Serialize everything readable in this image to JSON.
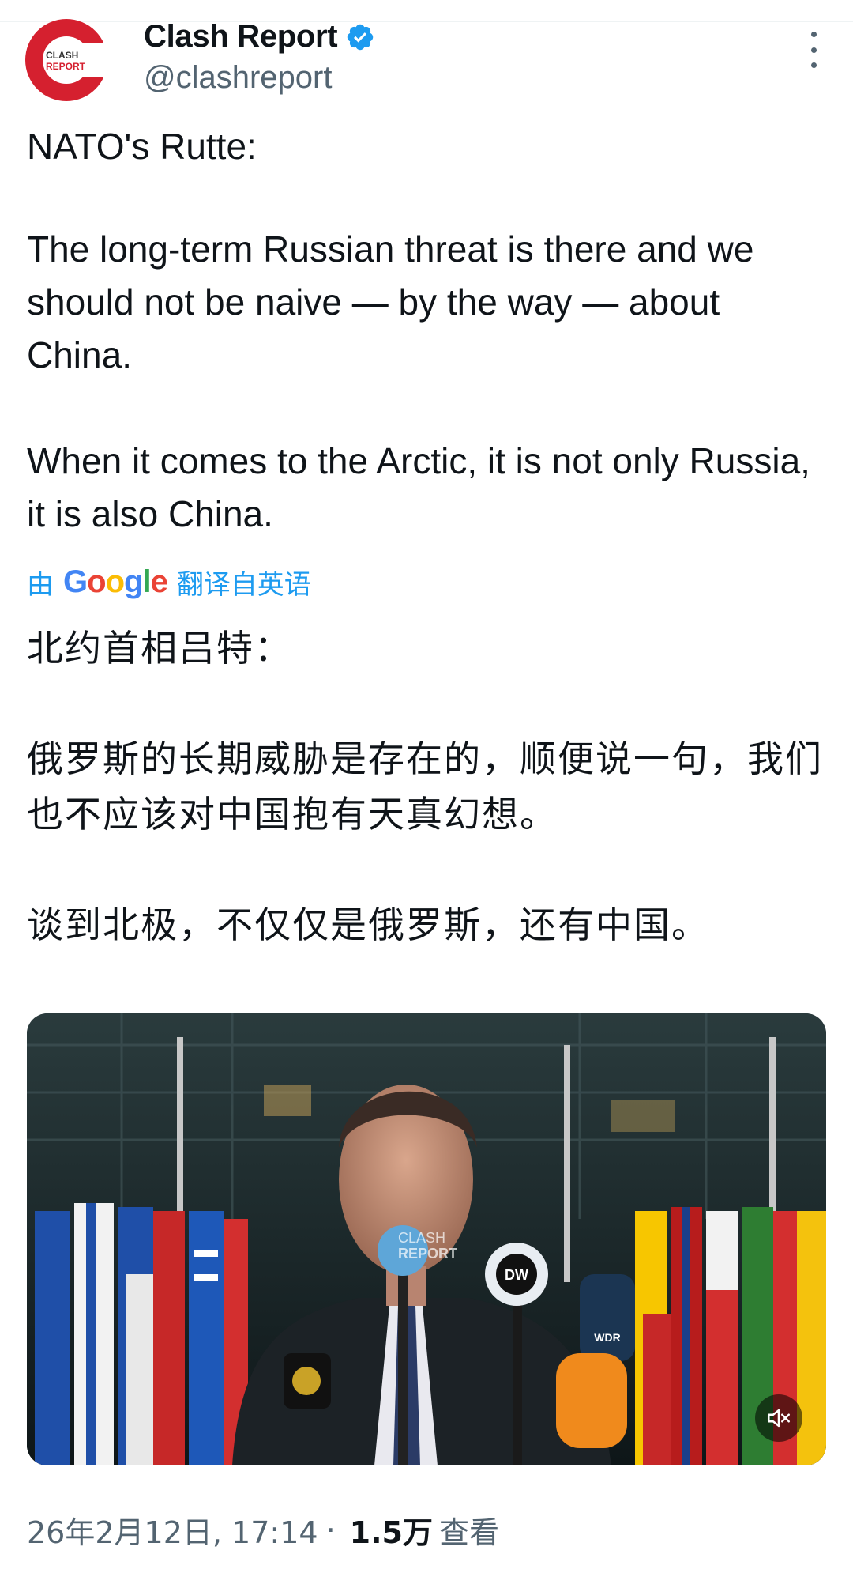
{
  "author": {
    "display_name": "Clash Report",
    "handle": "@clashreport",
    "avatar_text_top": "CLASH",
    "avatar_text_bottom": "REPORT",
    "verified": true
  },
  "tweet": {
    "paragraphs": [
      "NATO's Rutte:",
      "The long-term Russian threat is there and we should not be naive — by the way — about China.",
      "When it comes to the Arctic, it is not only Russia, it is also China."
    ]
  },
  "translation": {
    "by_label": "由",
    "provider": "Google",
    "suffix_label": "翻译自英语",
    "paragraphs": [
      "北约首相吕特：",
      "俄罗斯的长期威胁是存在的，顺便说一句，我们也不应该对中国抱有天真幻想。",
      "谈到北极，不仅仅是俄罗斯，还有中国。"
    ]
  },
  "media": {
    "watermark_top": "CLASH",
    "watermark_bottom": "REPORT",
    "mic_labels": [
      "DW",
      "WDR"
    ]
  },
  "meta": {
    "timestamp": "26年2月12日, 17:14",
    "separator": "·",
    "views_count": "1.5万",
    "views_label": "查看"
  },
  "colors": {
    "brand_red": "#d5202f",
    "verified_blue": "#1d9bf0",
    "link_blue": "#1d9bf0",
    "secondary_text": "#536471"
  }
}
